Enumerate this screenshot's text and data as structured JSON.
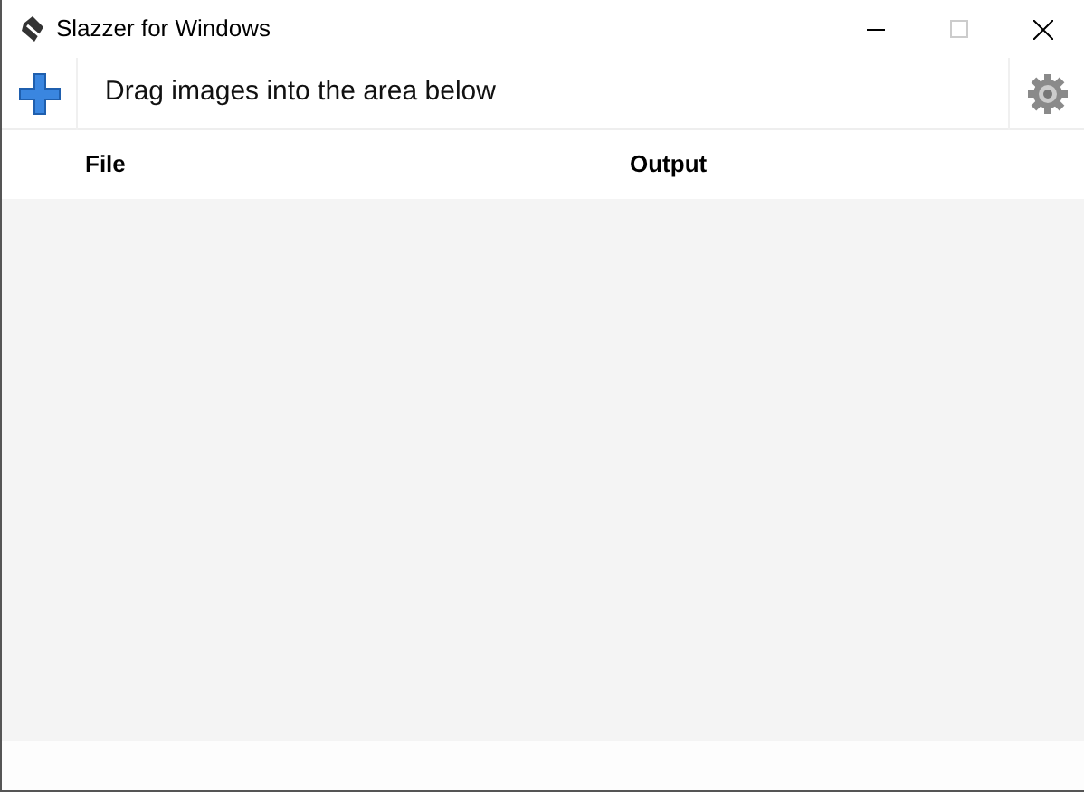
{
  "window": {
    "title": "Slazzer for Windows"
  },
  "toolbar": {
    "hint": "Drag images into the area below"
  },
  "table": {
    "columns": [
      {
        "label": "File"
      },
      {
        "label": "Output"
      }
    ]
  }
}
